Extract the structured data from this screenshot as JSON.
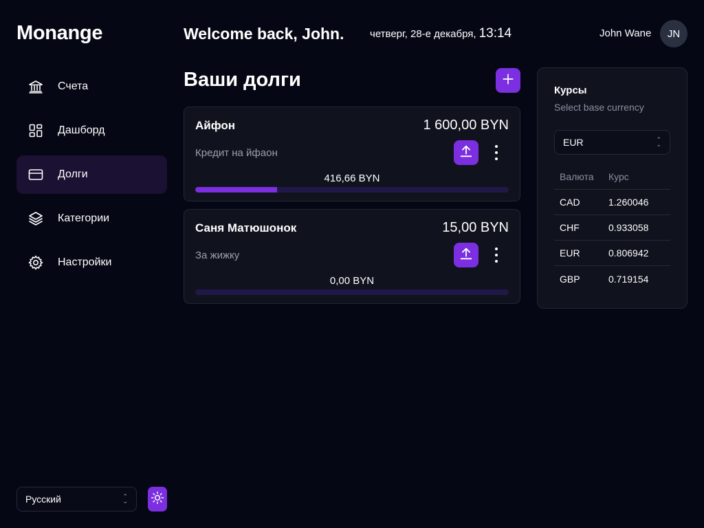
{
  "app": {
    "logo": "Monange"
  },
  "sidebar": {
    "items": [
      {
        "label": "Счета",
        "icon": "bank-icon",
        "active": false
      },
      {
        "label": "Дашборд",
        "icon": "dashboard-icon",
        "active": false
      },
      {
        "label": "Долги",
        "icon": "card-icon",
        "active": true
      },
      {
        "label": "Категории",
        "icon": "layers-icon",
        "active": false
      },
      {
        "label": "Настройки",
        "icon": "gear-icon",
        "active": false
      }
    ],
    "language": "Русский",
    "theme_icon": "sun-icon"
  },
  "header": {
    "welcome": "Welcome back, John.",
    "date": "четверг, 28-е декабря,",
    "time": "13:14",
    "user_name": "John Wane",
    "avatar_initials": "JN"
  },
  "debts": {
    "title": "Ваши долги",
    "add_icon": "plus-icon",
    "items": [
      {
        "name": "Айфон",
        "amount": "1 600,00 BYN",
        "description": "Кредит на йфаон",
        "paid": "416,66 BYN",
        "progress": 0.26
      },
      {
        "name": "Саня Матюшонок",
        "amount": "15,00 BYN",
        "description": "За жижку",
        "paid": "0,00 BYN",
        "progress": 0
      }
    ]
  },
  "rates": {
    "title": "Курсы",
    "subtitle": "Select base currency",
    "base_currency": "EUR",
    "headers": [
      "Валюта",
      "Курс"
    ],
    "rows": [
      [
        "CAD",
        "1.260046"
      ],
      [
        "CHF",
        "0.933058"
      ],
      [
        "EUR",
        "0.806942"
      ],
      [
        "GBP",
        "0.719154"
      ]
    ]
  },
  "colors": {
    "accent": "#7b2fe0",
    "background": "#050714",
    "card": "#10131e"
  }
}
